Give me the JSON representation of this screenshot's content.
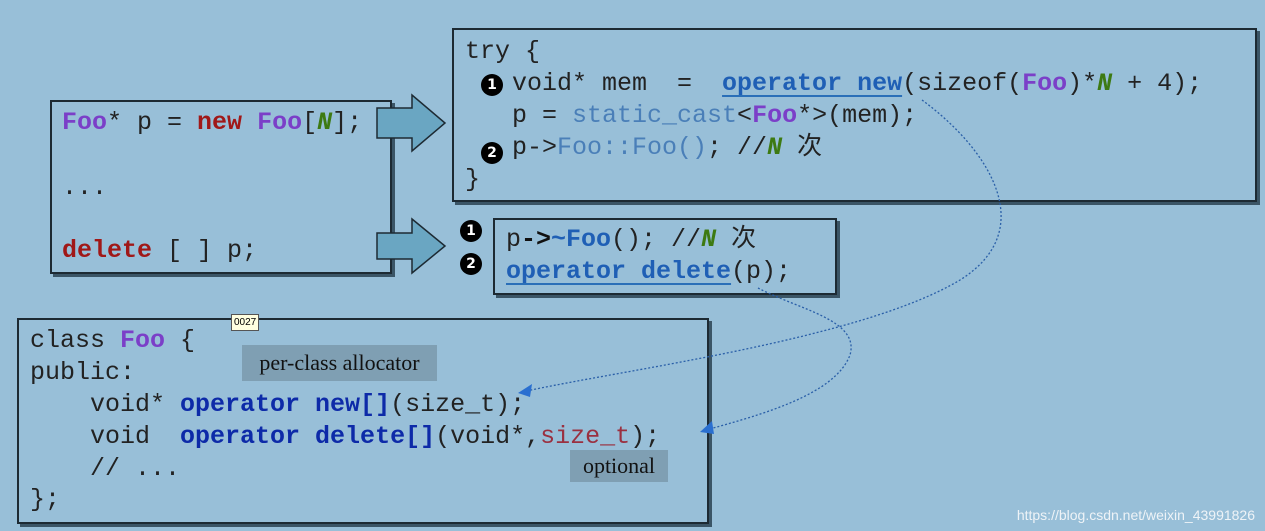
{
  "colors": {
    "background": "#98bfd8",
    "block_arrow": "#6aa6c2",
    "dotted_connector": "#2a5fa8"
  },
  "left_box": {
    "lines": [
      [
        {
          "t": "Foo",
          "c": "k-purple"
        },
        {
          "t": "* p = ",
          "c": "k-plain"
        },
        {
          "t": "new",
          "c": "k-red"
        },
        {
          "t": " ",
          "c": "k-plain"
        },
        {
          "t": "Foo",
          "c": "k-purple"
        },
        {
          "t": "[",
          "c": "k-plain"
        },
        {
          "t": "N",
          "c": "k-green"
        },
        {
          "t": "];",
          "c": "k-plain"
        }
      ],
      [
        {
          "t": "...",
          "c": "k-plain"
        }
      ],
      [
        {
          "t": "delete",
          "c": "k-red"
        },
        {
          "t": " [ ] p;",
          "c": "k-plain"
        }
      ]
    ]
  },
  "try_box": {
    "lines": [
      [
        {
          "t": "try {",
          "c": "k-plain"
        }
      ],
      [
        {
          "t": "void* mem  =  ",
          "c": "k-plain"
        },
        {
          "t": "operator new",
          "c": "k-blue-u"
        },
        {
          "t": "(sizeof(",
          "c": "k-plain"
        },
        {
          "t": "Foo",
          "c": "k-purple"
        },
        {
          "t": ")*",
          "c": "k-plain"
        },
        {
          "t": "N",
          "c": "k-green"
        },
        {
          "t": " + 4);",
          "c": "k-plain"
        }
      ],
      [
        {
          "t": "p = ",
          "c": "k-plain"
        },
        {
          "t": "static_cast",
          "c": "k-lblue"
        },
        {
          "t": "<",
          "c": "k-plain"
        },
        {
          "t": "Foo",
          "c": "k-purple"
        },
        {
          "t": "*>(mem);",
          "c": "k-plain"
        }
      ],
      [
        {
          "t": "p->",
          "c": "k-plain"
        },
        {
          "t": "Foo::Foo()",
          "c": "k-lblue"
        },
        {
          "t": "; //",
          "c": "k-plain"
        },
        {
          "t": "N",
          "c": "k-green"
        },
        {
          "t": " 次",
          "c": "k-plain"
        }
      ],
      [
        {
          "t": "}",
          "c": "k-plain"
        }
      ]
    ],
    "badges": [
      "1",
      "2"
    ]
  },
  "delete_box": {
    "lines": [
      [
        {
          "t": "p",
          "c": "k-plain"
        },
        {
          "t": "->",
          "c": "k-black-b"
        },
        {
          "t": "~Foo",
          "c": "k-blue"
        },
        {
          "t": "(); //",
          "c": "k-plain"
        },
        {
          "t": "N",
          "c": "k-green"
        },
        {
          "t": " 次",
          "c": "k-plain"
        }
      ],
      [
        {
          "t": "operator delete",
          "c": "k-blue-u"
        },
        {
          "t": "(p);",
          "c": "k-plain"
        }
      ]
    ],
    "badges": [
      "1",
      "2"
    ]
  },
  "class_box": {
    "lines": [
      [
        {
          "t": "class ",
          "c": "k-plain"
        },
        {
          "t": "Foo",
          "c": "k-purple"
        },
        {
          "t": " {",
          "c": "k-plain"
        }
      ],
      [
        {
          "t": "public:",
          "c": "k-plain"
        }
      ],
      [
        {
          "t": "    void* ",
          "c": "k-plain"
        },
        {
          "t": "operator new[]",
          "c": "k-navy"
        },
        {
          "t": "(size_t);",
          "c": "k-plain"
        }
      ],
      [
        {
          "t": "    void  ",
          "c": "k-plain"
        },
        {
          "t": "operator delete[]",
          "c": "k-navy"
        },
        {
          "t": "(void*,",
          "c": "k-plain"
        },
        {
          "t": "size_t",
          "c": "k-maroon"
        },
        {
          "t": ");",
          "c": "k-plain"
        }
      ],
      [
        {
          "t": "    // ...",
          "c": "k-plain"
        }
      ],
      [
        {
          "t": "};",
          "c": "k-plain"
        }
      ]
    ]
  },
  "labels": {
    "per_class": "per-class allocator",
    "optional": "optional",
    "tag": "0027"
  },
  "watermark": "https://blog.csdn.net/weixin_43991826"
}
